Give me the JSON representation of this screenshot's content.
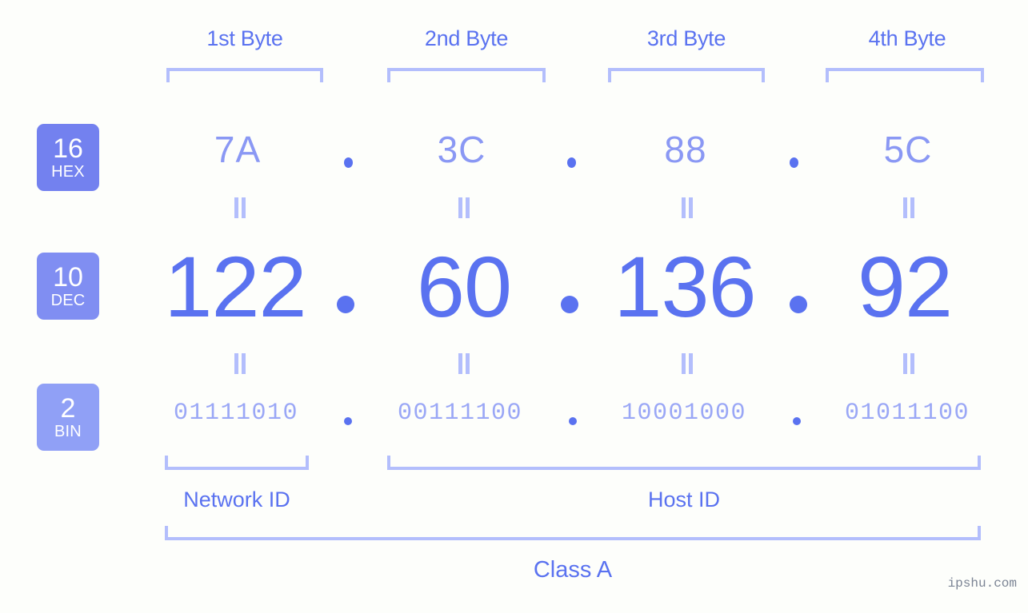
{
  "meta": {
    "background_color": "#fdfefb",
    "accent_color": "#5a72f0",
    "light_accent_color": "#b3befc",
    "mid_accent_color": "#8a98f4",
    "watermark": "ipshu.com"
  },
  "byte_headers": [
    {
      "label": "1st Byte"
    },
    {
      "label": "2nd Byte"
    },
    {
      "label": "3rd Byte"
    },
    {
      "label": "4th Byte"
    }
  ],
  "rows": {
    "hex": {
      "badge_number": "16",
      "badge_name": "HEX",
      "badge_color": "#7381ef",
      "values": [
        "7A",
        "3C",
        "88",
        "5C"
      ],
      "separator": "."
    },
    "dec": {
      "badge_number": "10",
      "badge_name": "DEC",
      "badge_color": "#808ef2",
      "values": [
        "122",
        "60",
        "136",
        "92"
      ],
      "separator": "."
    },
    "bin": {
      "badge_number": "2",
      "badge_name": "BIN",
      "badge_color": "#90a0f6",
      "values": [
        "01111010",
        "00111100",
        "10001000",
        "01011100"
      ],
      "separator": "."
    }
  },
  "footer": {
    "network_id_label": "Network ID",
    "host_id_label": "Host ID",
    "class_label": "Class A"
  }
}
